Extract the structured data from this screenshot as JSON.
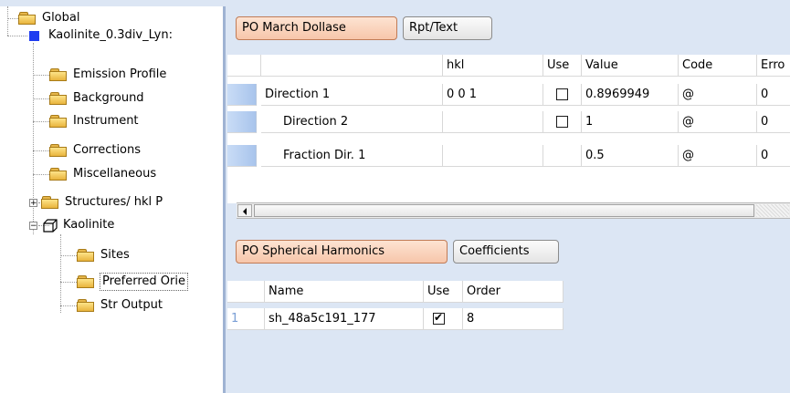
{
  "tree": {
    "items": [
      {
        "label": "Global"
      },
      {
        "label": "Kaolinite_0.3div_Lyn:"
      },
      {
        "label": "Emission Profile"
      },
      {
        "label": "Background"
      },
      {
        "label": "Instrument"
      },
      {
        "label": "Corrections"
      },
      {
        "label": "Miscellaneous"
      },
      {
        "label": "Structures/ hkl P"
      },
      {
        "label": "Kaolinite"
      },
      {
        "label": "Sites"
      },
      {
        "label": "Preferred Orie"
      },
      {
        "label": "Str Output"
      }
    ]
  },
  "po_march": {
    "tab_active": "PO March Dollase",
    "tab_other": "Rpt/Text",
    "columns": [
      "hkl",
      "Use",
      "Value",
      "Code",
      "Erro"
    ],
    "rows": [
      {
        "name": "Direction 1",
        "hkl": "0 0 1",
        "use": false,
        "value": "0.8969949",
        "code": "@",
        "error": "0"
      },
      {
        "name": "Direction 2",
        "hkl": "",
        "use": false,
        "value": "1",
        "code": "@",
        "error": "0"
      },
      {
        "name": "Fraction Dir. 1",
        "hkl": "",
        "use": null,
        "value": "0.5",
        "code": "@",
        "error": "0"
      }
    ]
  },
  "po_sph": {
    "tab_active": "PO Spherical Harmonics",
    "tab_other": "Coefficients",
    "columns": [
      "Name",
      "Use",
      "Order"
    ],
    "rows": [
      {
        "index": "1",
        "name": "sh_48a5c191_177",
        "use": true,
        "order": "8"
      }
    ]
  },
  "colors": {
    "background": "#dce6f4",
    "active_tab": "#f7c6aa",
    "row_header": "#a8c4ec",
    "selected_node": "#1f3cf0"
  }
}
